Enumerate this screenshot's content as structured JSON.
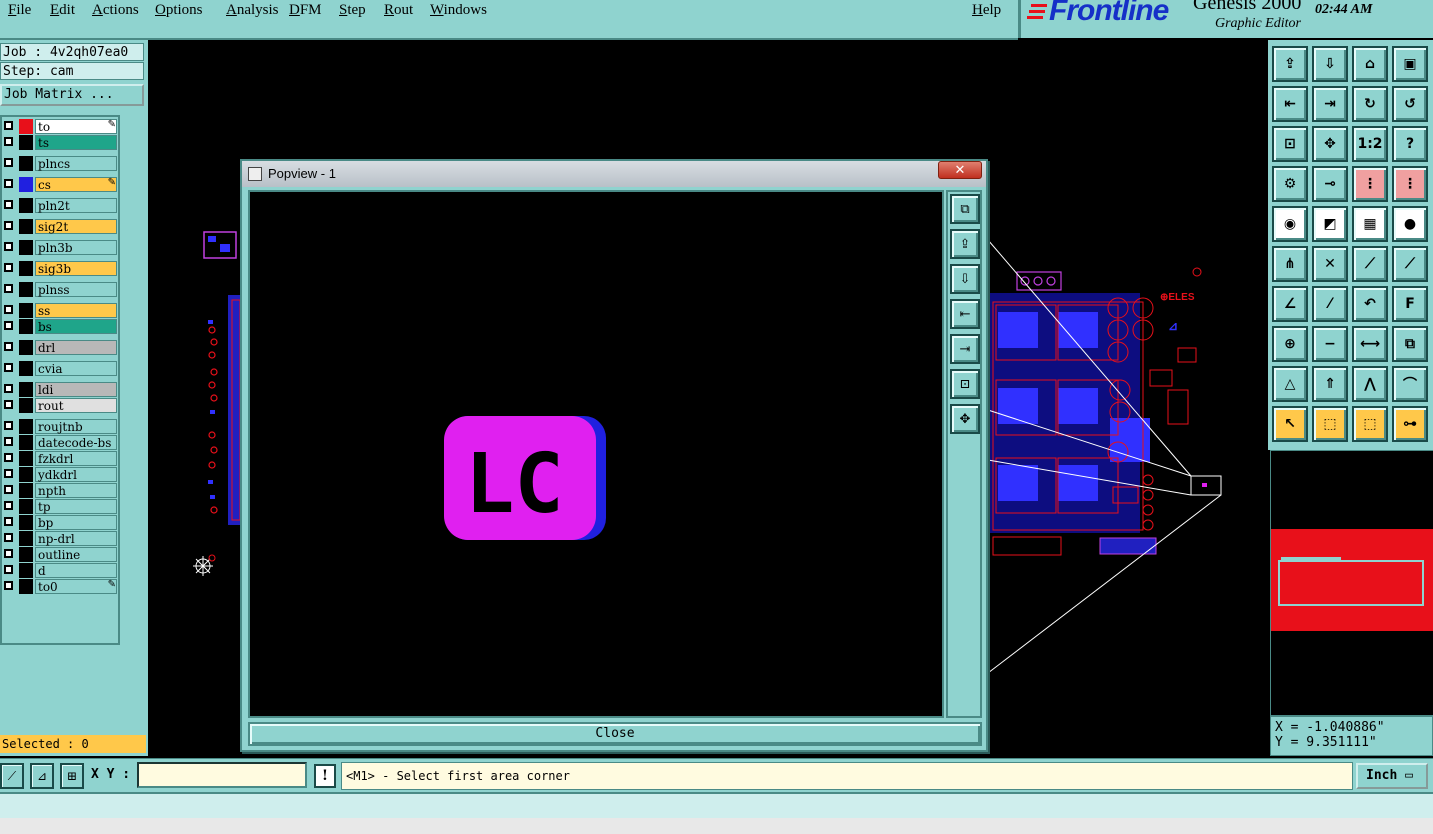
{
  "menu": {
    "items": [
      "File",
      "Edit",
      "Actions",
      "Options",
      "Analysis",
      "DFM",
      "Step",
      "Rout",
      "Windows"
    ],
    "help": "Help"
  },
  "brand": {
    "logo": "Frontline",
    "product": "Genesis 2000",
    "subtitle": "Graphic Editor",
    "clock": "02:44 AM"
  },
  "job": {
    "job_line": "Job : 4v2qh07ea0",
    "step_line": "Step: cam",
    "matrix_button": "Job Matrix ..."
  },
  "layers": [
    {
      "name": "to",
      "color": "#ffffff",
      "swatch": "#e8101a",
      "mark": "✎"
    },
    {
      "name": "ts",
      "color": "#1fa58a",
      "swatch": "#000000",
      "mark": ""
    },
    {
      "name": "plncs",
      "color": "#8fd3cf",
      "swatch": "#000000",
      "mark": ""
    },
    {
      "name": "cs",
      "color": "#ffc84a",
      "swatch": "#2020e0",
      "mark": "✎"
    },
    {
      "name": "pln2t",
      "color": "#8fd3cf",
      "swatch": "#000000",
      "mark": ""
    },
    {
      "name": "sig2t",
      "color": "#ffc84a",
      "swatch": "#000000",
      "mark": ""
    },
    {
      "name": "pln3b",
      "color": "#8fd3cf",
      "swatch": "#000000",
      "mark": ""
    },
    {
      "name": "sig3b",
      "color": "#ffc84a",
      "swatch": "#000000",
      "mark": ""
    },
    {
      "name": "plnss",
      "color": "#8fd3cf",
      "swatch": "#000000",
      "mark": ""
    },
    {
      "name": "ss",
      "color": "#ffc84a",
      "swatch": "#000000",
      "mark": ""
    },
    {
      "name": "bs",
      "color": "#1fa58a",
      "swatch": "#000000",
      "mark": ""
    },
    {
      "name": "drl",
      "color": "#b8b8b8",
      "swatch": "#000000",
      "mark": ""
    },
    {
      "name": "cvia",
      "color": "#8fd3cf",
      "swatch": "#000000",
      "mark": ""
    },
    {
      "name": "ldi",
      "color": "#b8b8b8",
      "swatch": "#000000",
      "mark": ""
    },
    {
      "name": "rout",
      "color": "#e0e0e0",
      "swatch": "#000000",
      "mark": ""
    },
    {
      "name": "roujtnb",
      "color": "#8fd3cf",
      "swatch": "#000000",
      "mark": ""
    },
    {
      "name": "datecode-bs",
      "color": "#8fd3cf",
      "swatch": "#000000",
      "mark": ""
    },
    {
      "name": "fzkdrl",
      "color": "#8fd3cf",
      "swatch": "#000000",
      "mark": ""
    },
    {
      "name": "ydkdrl",
      "color": "#8fd3cf",
      "swatch": "#000000",
      "mark": ""
    },
    {
      "name": "npth",
      "color": "#8fd3cf",
      "swatch": "#000000",
      "mark": ""
    },
    {
      "name": "tp",
      "color": "#8fd3cf",
      "swatch": "#000000",
      "mark": ""
    },
    {
      "name": "bp",
      "color": "#8fd3cf",
      "swatch": "#000000",
      "mark": ""
    },
    {
      "name": "np-drl",
      "color": "#8fd3cf",
      "swatch": "#000000",
      "mark": ""
    },
    {
      "name": "outline",
      "color": "#8fd3cf",
      "swatch": "#000000",
      "mark": ""
    },
    {
      "name": "d",
      "color": "#8fd3cf",
      "swatch": "#000000",
      "mark": ""
    },
    {
      "name": "to0",
      "color": "#8fd3cf",
      "swatch": "#000000",
      "mark": "✎"
    }
  ],
  "selected": "Selected : 0",
  "popview": {
    "title": "Popview - 1",
    "close_x": "✕",
    "close_button": "Close",
    "logo_text": "LC"
  },
  "coords": {
    "x": "X = -1.040886\"",
    "y": "Y = 9.351111\""
  },
  "status": {
    "xy_label": "X Y :",
    "xy_value": "",
    "prompt": "<M1> - Select first area corner",
    "units": "Inch",
    "excl": "!"
  },
  "colors": {
    "panel": "#8fd3cf",
    "accent_orange": "#ffc84a",
    "magenta": "#e020f0",
    "blue": "#2020e0",
    "red": "#e8101a"
  }
}
